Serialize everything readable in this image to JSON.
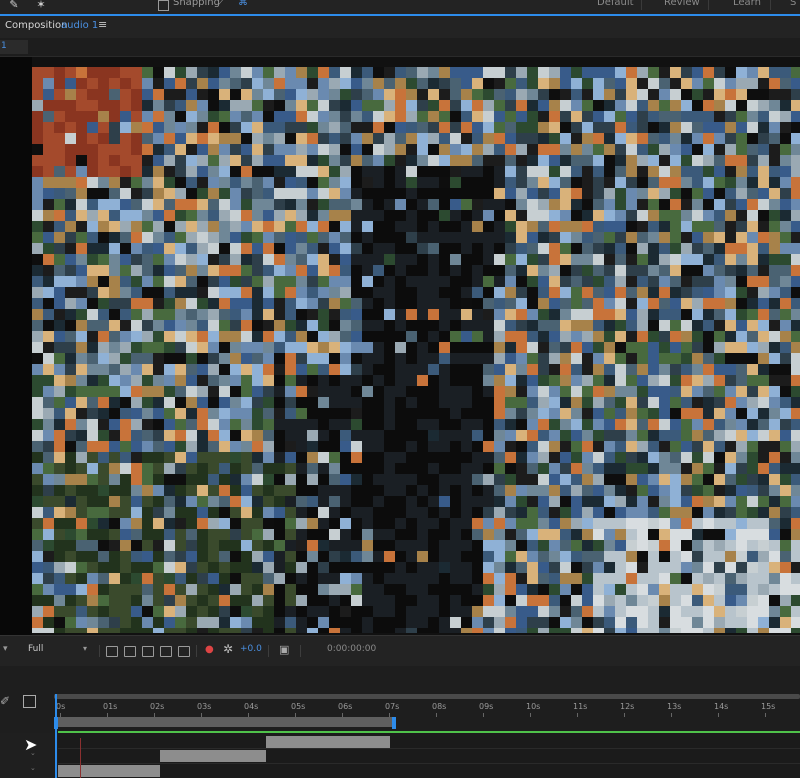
{
  "toolbar": {
    "snapping_label": "Snapping",
    "workspaces": [
      "Default",
      "Review",
      "Learn",
      "S"
    ]
  },
  "panel": {
    "title": "Composition",
    "comp_name": "audio 1",
    "menu_glyph": "≡",
    "tab_index": "1"
  },
  "viewer_controls": {
    "resolution": "Full",
    "exposure": "+0.0",
    "timecode": "0:00:00:00"
  },
  "timeline": {
    "ticks": [
      "0s",
      "01s",
      "02s",
      "03s",
      "04s",
      "05s",
      "06s",
      "07s",
      "08s",
      "09s",
      "10s",
      "11s",
      "12s",
      "13s",
      "14s",
      "15s"
    ]
  },
  "icons": {
    "pen": "pen-icon",
    "star": "puppet-pin-icon",
    "snap": "snapping-checkbox",
    "region": "region-of-interest-icon",
    "camera": "snapshot-camera-icon",
    "color": "color-channel-icon",
    "gear": "fast-preview-icon"
  },
  "colors": {
    "accent": "#2d8ceb",
    "layer_green": "#4fc24a"
  }
}
